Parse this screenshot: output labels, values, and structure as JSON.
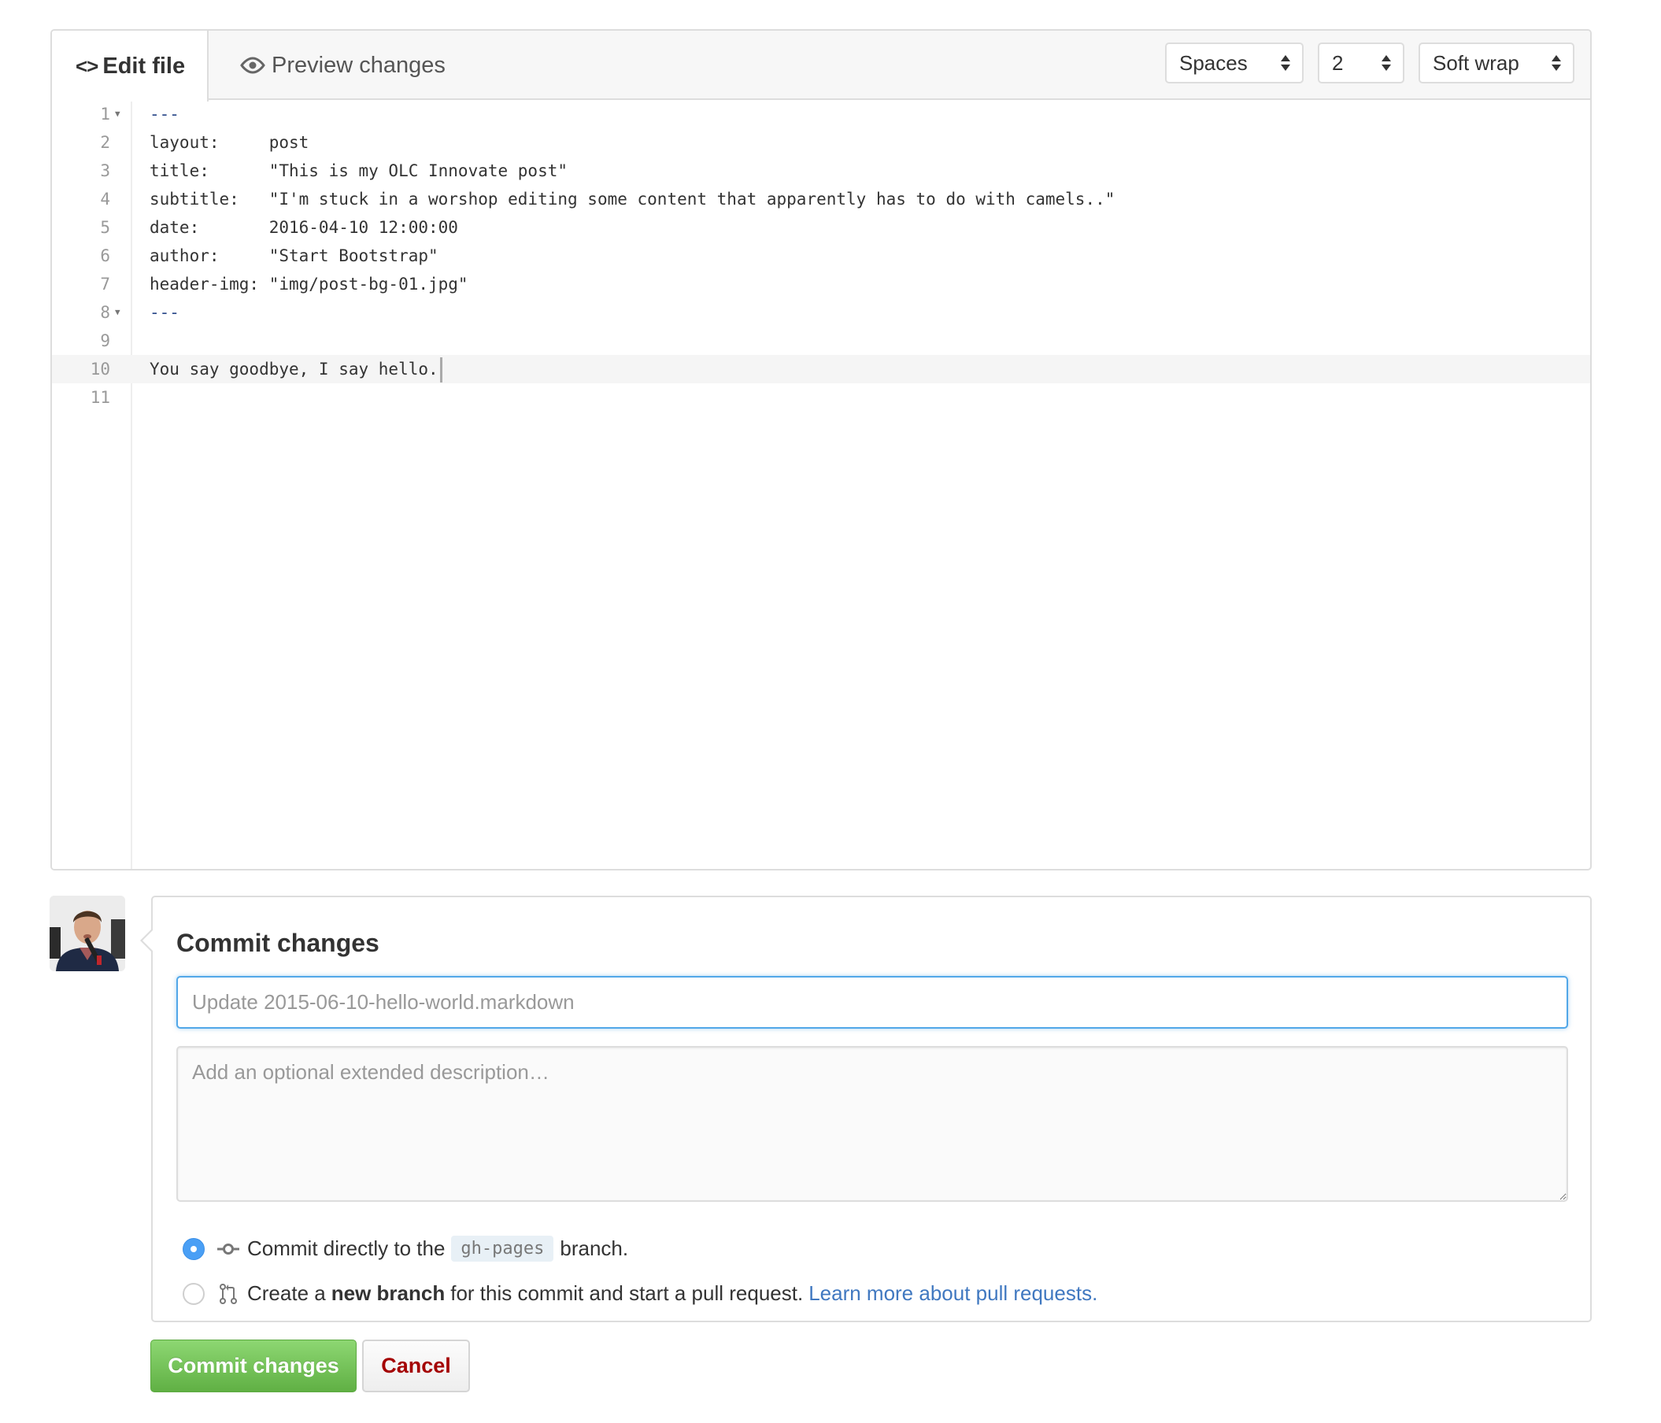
{
  "editor": {
    "tabs": [
      {
        "label": "Edit file",
        "icon": "code-icon",
        "active": true
      },
      {
        "label": "Preview changes",
        "icon": "eye-icon",
        "active": false
      }
    ],
    "selects": {
      "indent_mode": "Spaces",
      "indent_size": "2",
      "wrap_mode": "Soft wrap"
    },
    "lines": [
      {
        "no": "1",
        "text": "---",
        "foldable": true
      },
      {
        "no": "2",
        "text": "layout:     post"
      },
      {
        "no": "3",
        "text": "title:      \"This is my OLC Innovate post\""
      },
      {
        "no": "4",
        "text": "subtitle:   \"I'm stuck in a worshop editing some content that apparently has to do with camels..\""
      },
      {
        "no": "5",
        "text": "date:       2016-04-10 12:00:00"
      },
      {
        "no": "6",
        "text": "author:     \"Start Bootstrap\""
      },
      {
        "no": "7",
        "text": "header-img: \"img/post-bg-01.jpg\""
      },
      {
        "no": "8",
        "text": "---",
        "foldable": true
      },
      {
        "no": "9",
        "text": ""
      },
      {
        "no": "10",
        "text": "You say goodbye, I say hello.",
        "active": true
      },
      {
        "no": "11",
        "text": ""
      }
    ]
  },
  "commit": {
    "title": "Commit changes",
    "summary_placeholder": "Update 2015-06-10-hello-world.markdown",
    "summary_value": "",
    "description_placeholder": "Add an optional extended description…",
    "option_direct": {
      "prefix": "Commit directly to the",
      "branch": "gh-pages",
      "suffix": "branch.",
      "selected": true
    },
    "option_new_branch": {
      "prefix": "Create a",
      "bold": "new branch",
      "suffix": "for this commit and start a pull request.",
      "link": "Learn more about pull requests.",
      "selected": false
    },
    "submit_label": "Commit changes",
    "cancel_label": "Cancel"
  },
  "colors": {
    "accent_blue": "#4a9ff5",
    "link": "#4078c0",
    "commit_green": "#60b044",
    "cancel_red": "#a40000",
    "focus_border": "#51a7e8"
  }
}
